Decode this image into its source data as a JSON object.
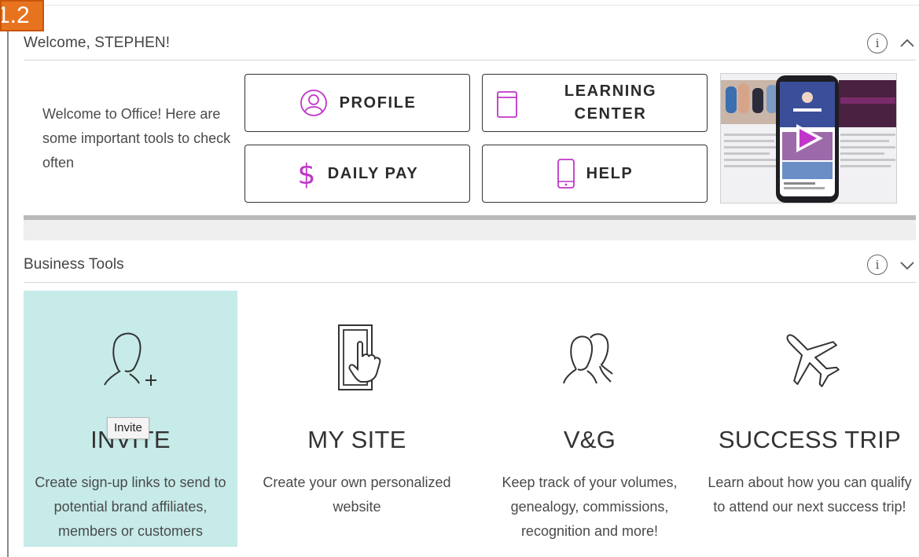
{
  "step_badge": "1.2",
  "welcome_section": {
    "title": "Welcome, STEPHEN!",
    "intro_text": "Welcome to Office! Here are some important tools to check often",
    "buttons": {
      "profile": "PROFILE",
      "learning_center_line1": "LEARNING",
      "learning_center_line2": "CENTER",
      "daily_pay": "DAILY PAY",
      "help": "HELP"
    },
    "video_thumbnail": {
      "screen_title": "Welcome to Nu Skin!",
      "side_label_right": "ELOCITY",
      "side_text_right": "Out How Our Sales rmance Program"
    }
  },
  "business_tools": {
    "title": "Business Tools",
    "tiles": [
      {
        "title": "INVITE",
        "description": "Create sign-up links to send to potential brand affiliates, members or customers",
        "icon": "person-add-icon"
      },
      {
        "title": "MY SITE",
        "description": "Create your own personalized website",
        "icon": "tablet-touch-icon"
      },
      {
        "title": "V&G",
        "description": "Keep track of your volumes, genealogy, commissions, recognition and more!",
        "icon": "people-icon"
      },
      {
        "title": "SUCCESS TRIP",
        "description": "Learn about how you can qualify to attend our next success trip!",
        "icon": "airplane-icon"
      }
    ],
    "tooltip": "Invite"
  },
  "colors": {
    "accent_magenta": "#c035c8",
    "active_tile": "#c6ebe9",
    "badge_orange": "#e8731f"
  }
}
